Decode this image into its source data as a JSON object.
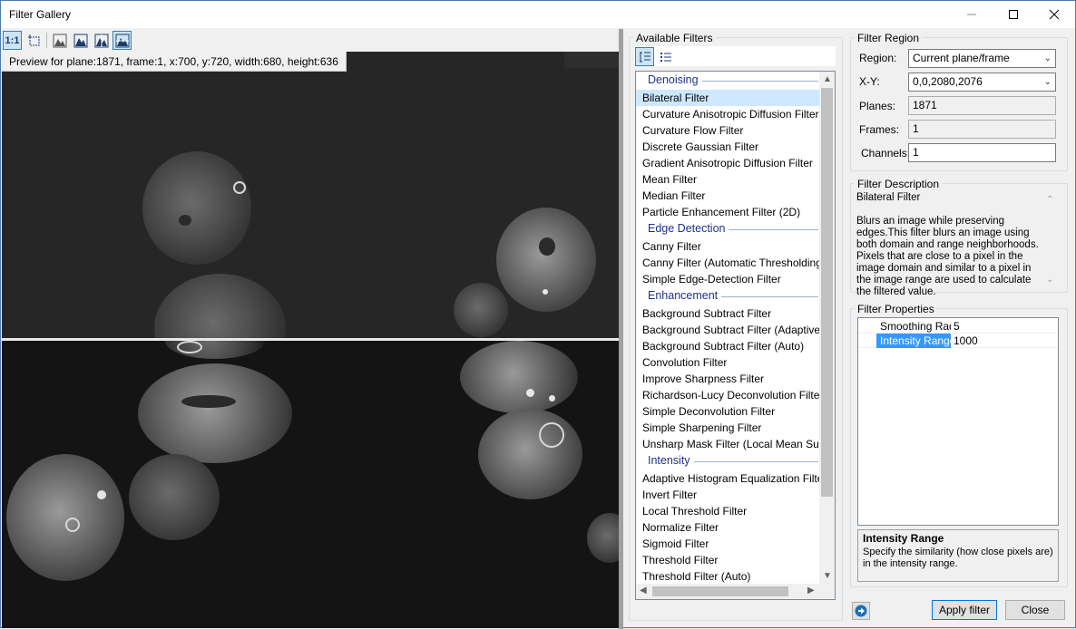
{
  "window": {
    "title": "Filter Gallery"
  },
  "preview": {
    "toolbar": {
      "one_to_one_label": "1:1"
    },
    "caption": "Preview for plane:1871, frame:1, x:700, y:720, width:680, height:636"
  },
  "filters": {
    "group_title": "Available Filters",
    "categories": [
      {
        "name": "Denoising",
        "items": [
          "Bilateral Filter",
          "Curvature Anisotropic Diffusion Filter",
          "Curvature Flow Filter",
          "Discrete Gaussian Filter",
          "Gradient Anisotropic Diffusion Filter",
          "Mean Filter",
          "Median Filter",
          "Particle Enhancement Filter (2D)"
        ]
      },
      {
        "name": "Edge Detection",
        "items": [
          "Canny Filter",
          "Canny Filter (Automatic Thresholding)",
          "Simple Edge-Detection Filter"
        ]
      },
      {
        "name": "Enhancement",
        "items": [
          "Background Subtract Filter",
          "Background Subtract Filter (Adaptive)",
          "Background Subtract Filter (Auto)",
          "Convolution Filter",
          "Improve Sharpness Filter",
          "Richardson-Lucy Deconvolution Filter",
          "Simple Deconvolution Filter",
          "Simple Sharpening Filter",
          "Unsharp Mask Filter (Local Mean Subtrac"
        ]
      },
      {
        "name": "Intensity",
        "items": [
          "Adaptive Histogram Equalization Filter",
          "Invert Filter",
          "Local Threshold Filter",
          "Normalize Filter",
          "Sigmoid Filter",
          "Threshold Filter",
          "Threshold Filter (Auto)"
        ]
      }
    ],
    "selected": "Bilateral Filter"
  },
  "region": {
    "group_title": "Filter Region",
    "region_label": "Region:",
    "region_value": "Current plane/frame",
    "xy_label": "X-Y:",
    "xy_value": "0,0,2080,2076",
    "planes_label": "Planes:",
    "planes_value": "1871",
    "frames_label": "Frames:",
    "frames_value": "1",
    "channels_label": "Channels:",
    "channels_value": "1"
  },
  "description": {
    "group_title": "Filter Description",
    "name": "Bilateral Filter",
    "text": "Blurs an image while preserving edges.This filter blurs an image using both domain and range neighborhoods. Pixels that are close to a pixel in the image domain and similar to a pixel in the image range are used to calculate the filtered value."
  },
  "properties": {
    "group_title": "Filter Properties",
    "rows": [
      {
        "name": "Smoothing Radii",
        "value": "5"
      },
      {
        "name": "Intensity Range",
        "value": "1000"
      }
    ],
    "help_title": "Intensity Range",
    "help_text": "Specify the similarity (how close pixels are) in the intensity range."
  },
  "buttons": {
    "apply": "Apply filter",
    "close": "Close"
  }
}
